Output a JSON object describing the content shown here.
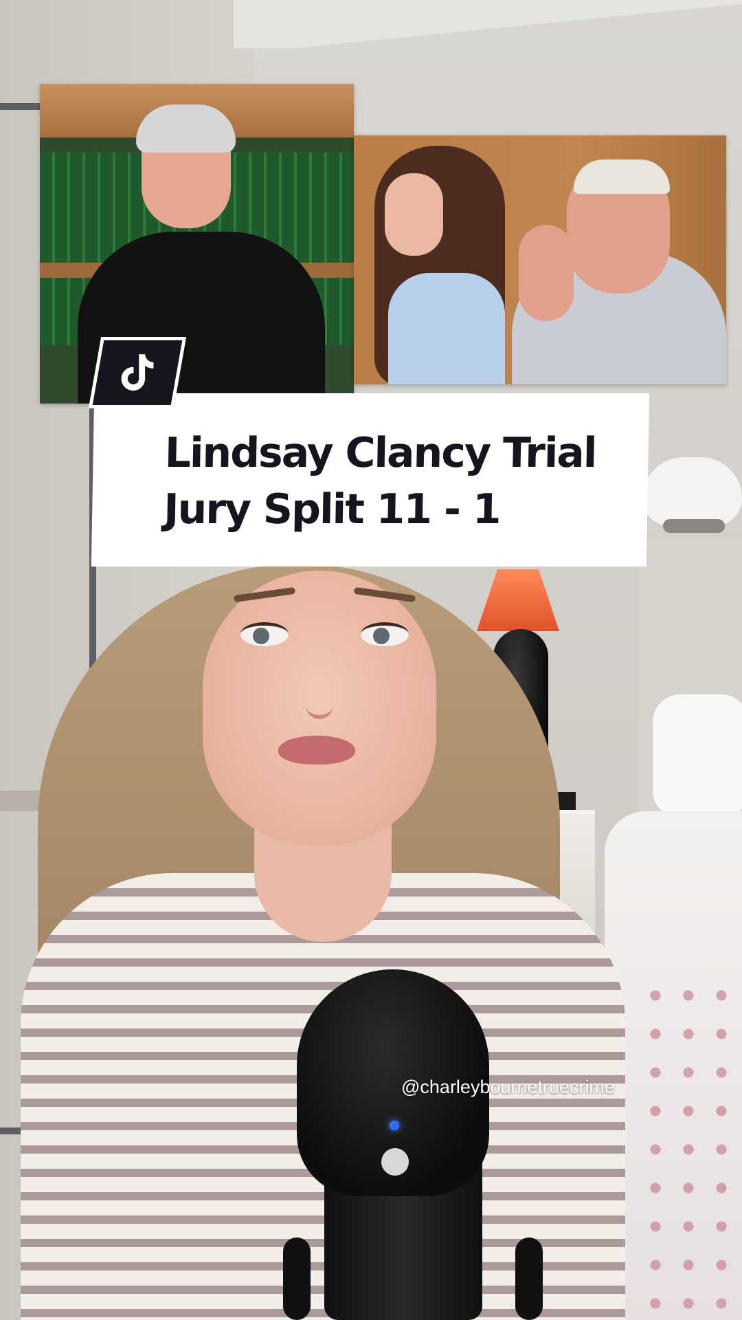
{
  "title_card": {
    "line1": "Lindsay Clancy Trial",
    "line2": "Jury Split 11 - 1"
  },
  "watermark": {
    "handle": "@charleybournetruecrime"
  },
  "badge": {
    "icon": "tiktok-logo-icon"
  },
  "colors": {
    "title_text": "#15151f",
    "badge_bg": "#16161f",
    "card_bg": "#ffffff"
  }
}
